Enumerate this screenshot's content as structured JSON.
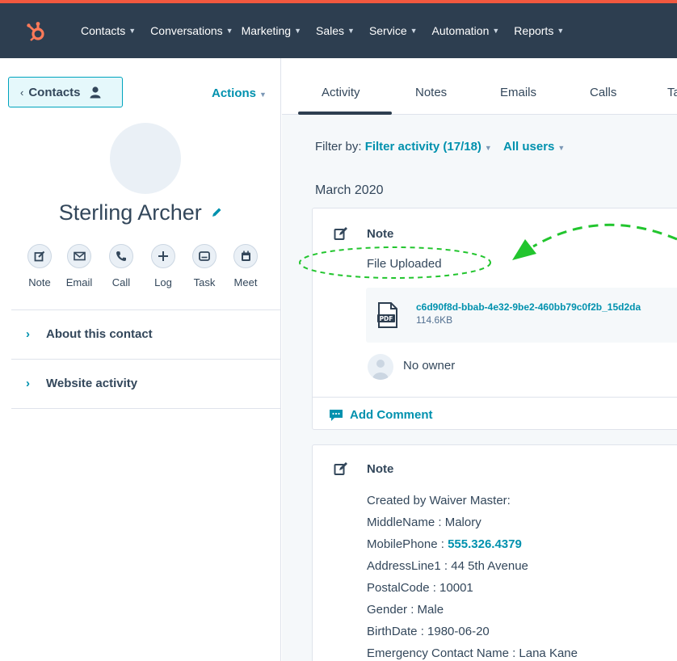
{
  "nav": {
    "items": [
      "Contacts",
      "Conversations",
      "Marketing",
      "Sales",
      "Service",
      "Automation",
      "Reports"
    ]
  },
  "sidebar": {
    "back_label": "Contacts",
    "actions_label": "Actions",
    "contact_name": "Sterling Archer",
    "quick_actions": [
      "Note",
      "Email",
      "Call",
      "Log",
      "Task",
      "Meet"
    ],
    "sections": [
      "About this contact",
      "Website activity"
    ]
  },
  "tabs": [
    "Activity",
    "Notes",
    "Emails",
    "Calls",
    "Ta"
  ],
  "filter": {
    "label": "Filter by:",
    "activity": "Filter activity (17/18)",
    "users": "All users"
  },
  "month": "March 2020",
  "note1": {
    "title": "Note",
    "body": "File Uploaded",
    "file_name": "c6d90f8d-bbab-4e32-9be2-460bb79c0f2b_15d2da",
    "file_size": "114.6KB",
    "owner": "No owner",
    "add_comment": "Add Comment"
  },
  "note2": {
    "title": "Note",
    "created_by": "Created by Waiver Master:",
    "middle_name": "MiddleName : Malory",
    "mobile_label": "MobilePhone : ",
    "mobile_value": "555.326.4379",
    "address": "AddressLine1 : 44 5th Avenue",
    "postal": "PostalCode : 10001",
    "gender": "Gender : Male",
    "birth": "BirthDate : 1980-06-20",
    "emergency": "Emergency Contact Name : Lana Kane"
  },
  "colors": {
    "nav_bg": "#2d3e50",
    "accent_orange": "#ff7a59",
    "link_teal": "#0091ae",
    "annotation_green": "#22c52e"
  },
  "icons": {
    "logo": "hubspot-sprocket-icon",
    "pdf": "pdf-file-icon",
    "note": "edit-note-icon"
  }
}
